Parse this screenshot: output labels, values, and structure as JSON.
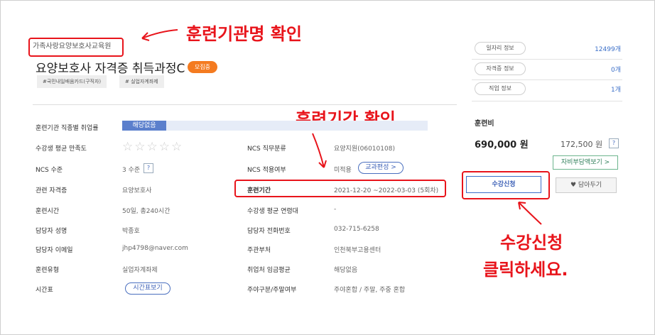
{
  "annotations": {
    "institution_check": "훈련기관명 확인",
    "period_check": "훈련기간 확인",
    "click_line1": "수강신청",
    "click_line2": "클릭하세요."
  },
  "course": {
    "institution": "가족사랑요양보호사교육원",
    "title": "요양보호사 자격증 취득과정C",
    "status_badge": "모집중",
    "tags": [
      "#국민내일배움카드(구직자)",
      "# 실업자계좌제"
    ]
  },
  "details": {
    "employment_rate": {
      "label": "훈련기관 직종별 취업률",
      "value": "해당없음"
    },
    "satisfaction": {
      "label": "수강생 평균 만족도",
      "stars": 0,
      "max_stars": 5
    },
    "ncs_level": {
      "label": "NCS 수준",
      "value": "3 수준",
      "help": "?"
    },
    "certificate": {
      "label": "관련 자격증",
      "value": "요양보호사"
    },
    "hours": {
      "label": "훈련시간",
      "value": "50일, 총240시간"
    },
    "manager_name": {
      "label": "담당자 성명",
      "value": "박종호"
    },
    "manager_email": {
      "label": "담당자 이메일",
      "value": "jhp4798@naver.com"
    },
    "training_type": {
      "label": "훈련유형",
      "value": "실업자계좌제"
    },
    "timetable": {
      "label": "시간표",
      "button": "시간표보기"
    },
    "ncs_category": {
      "label": "NCS 직무분류",
      "value": "요양지원(06010108)"
    },
    "ncs_applied": {
      "label": "NCS 적용여부",
      "value": "미적용",
      "button": "교과편성 >"
    },
    "period": {
      "label": "훈련기간",
      "value": "2021-12-20 ~2022-03-03 (5회차)"
    },
    "avg_age": {
      "label": "수강생 평균 연령대",
      "value": "-"
    },
    "manager_phone": {
      "label": "담당자 전화번호",
      "value": "032-715-6258"
    },
    "department": {
      "label": "주관부처",
      "value": "인천북부고용센터"
    },
    "wage": {
      "label": "취업처 임금평균",
      "value": "해당없음"
    },
    "day_type": {
      "label": "주야구분/주말여부",
      "value": "주야혼합 / 주말, 주중 혼합"
    }
  },
  "sidebar": {
    "info": [
      {
        "label": "일자리 정보",
        "value": "12499개"
      },
      {
        "label": "자격증 정보",
        "value": "0개"
      },
      {
        "label": "직업 정보",
        "value": "1개"
      }
    ],
    "fee_label": "훈련비",
    "fee": "690,000 원",
    "self_pay": "172,500 원",
    "help": "?",
    "subsidy_button": "자비부담액보기 >",
    "apply_button": "수강신청",
    "wish_button": "담아두기"
  },
  "colors": {
    "annotation": "#e8141b",
    "accent": "#3b6fc8",
    "badge": "#f47b20"
  }
}
